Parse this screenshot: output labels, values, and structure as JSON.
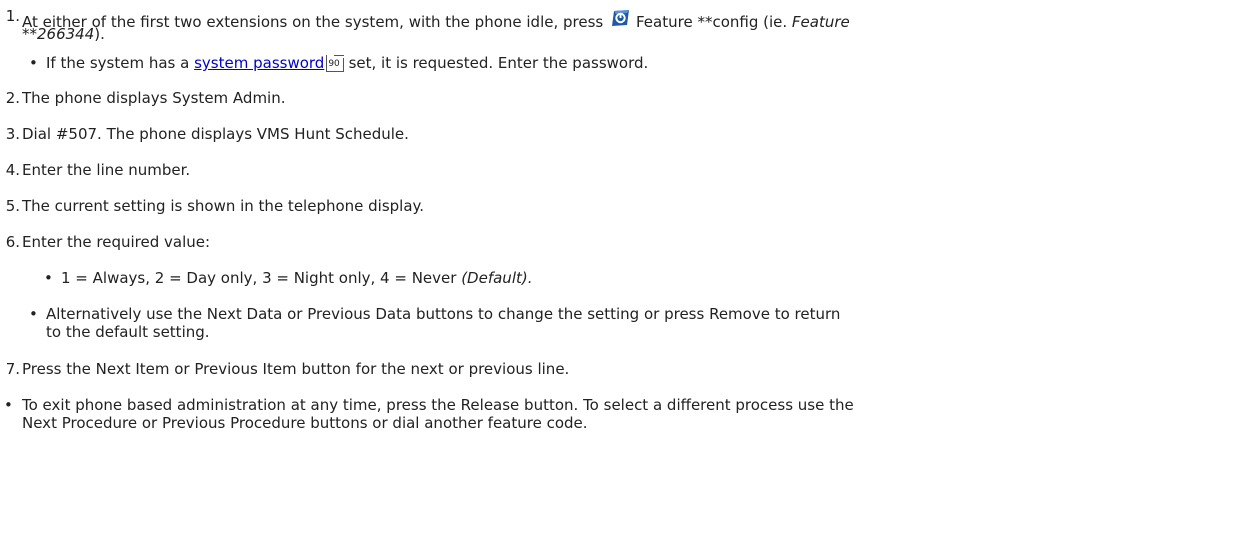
{
  "steps": {
    "s1": {
      "num": "1.",
      "text_a": "At either of the first two extensions on the system, with the phone idle, press",
      "icon": "feature-button-icon",
      "text_b": "Feature **config (ie.",
      "italic_a": "Feature",
      "italic_b": "**266344",
      "text_c": ")."
    },
    "s1_bullet": {
      "text_a": "If the system has a",
      "link": "system password",
      "xref": "90",
      "text_b": "set, it is requested. Enter the password."
    },
    "s2": {
      "num": "2.",
      "text": "The phone displays System Admin."
    },
    "s3": {
      "num": "3.",
      "text": "Dial #507. The phone displays VMS Hunt Schedule."
    },
    "s4": {
      "num": "4.",
      "text": "Enter the line number."
    },
    "s5": {
      "num": "5.",
      "text": "The current setting is shown in the telephone display."
    },
    "s6": {
      "num": "6.",
      "text": "Enter the required value:"
    },
    "s6_values": {
      "text": "1 = Always, 2 = Day only, 3 = Night only, 4 = Never",
      "italic": "(Default)."
    },
    "s6_alt": {
      "line1": "Alternatively use the Next Data or Previous Data buttons to change the setting or press Remove to return",
      "line2": "to the default setting."
    },
    "s7": {
      "num": "7.",
      "text": "Press the Next Item or Previous Item button for the next or previous line."
    },
    "note": {
      "line1": "To exit phone based administration at any time, press the Release button. To select a different process use the",
      "line2": "Next Procedure or Previous Procedure buttons or dial another feature code."
    }
  },
  "colors": {
    "text": "#222222",
    "link": "#0000cc",
    "icon_blue": "#1e5aa8"
  }
}
